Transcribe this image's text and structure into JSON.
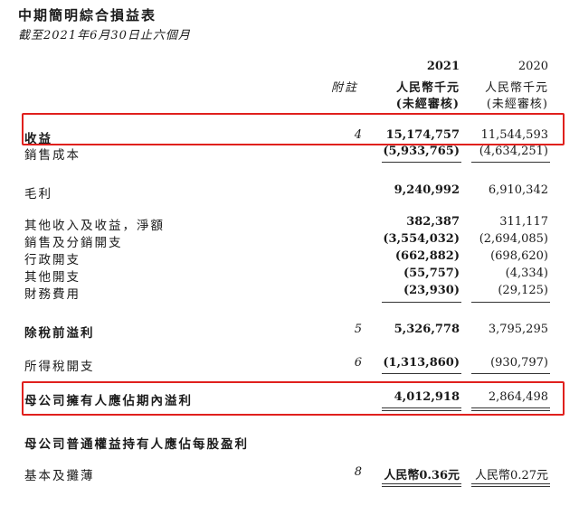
{
  "title": "中期簡明綜合損益表",
  "subtitle": "截至2021年6月30日止六個月",
  "header": {
    "note_label": "附註",
    "col2021_year": "2021",
    "col2021_unit": "人民幣千元",
    "col2021_status": "(未經審核)",
    "col2020_year": "2020",
    "col2020_unit": "人民幣千元",
    "col2020_status": "(未經審核)"
  },
  "rows": [
    {
      "label": "收益",
      "note": "4",
      "v2021": "15,174,757",
      "v2020": "11,544,593"
    },
    {
      "label": "銷售成本",
      "note": "",
      "v2021": "(5,933,765)",
      "v2020": "(4,634,251)"
    },
    {
      "label": "毛利",
      "note": "",
      "v2021": "9,240,992",
      "v2020": "6,910,342"
    },
    {
      "label": "其他收入及收益，淨額",
      "note": "",
      "v2021": "382,387",
      "v2020": "311,117"
    },
    {
      "label": "銷售及分銷開支",
      "note": "",
      "v2021": "(3,554,032)",
      "v2020": "(2,694,085)"
    },
    {
      "label": "行政開支",
      "note": "",
      "v2021": "(662,882)",
      "v2020": "(698,620)"
    },
    {
      "label": "其他開支",
      "note": "",
      "v2021": "(55,757)",
      "v2020": "(4,334)"
    },
    {
      "label": "財務費用",
      "note": "",
      "v2021": "(23,930)",
      "v2020": "(29,125)"
    },
    {
      "label": "除稅前溢利",
      "note": "5",
      "v2021": "5,326,778",
      "v2020": "3,795,295"
    },
    {
      "label": "所得稅開支",
      "note": "6",
      "v2021": "(1,313,860)",
      "v2020": "(930,797)"
    },
    {
      "label": "母公司擁有人應佔期內溢利",
      "note": "",
      "v2021": "4,012,918",
      "v2020": "2,864,498"
    }
  ],
  "eps": {
    "heading": "母公司普通權益持有人應佔每股盈利",
    "label": "基本及攤薄",
    "note": "8",
    "v2021": "人民幣0.36元",
    "v2020": "人民幣0.27元"
  },
  "highlight_color": "#e0201d"
}
